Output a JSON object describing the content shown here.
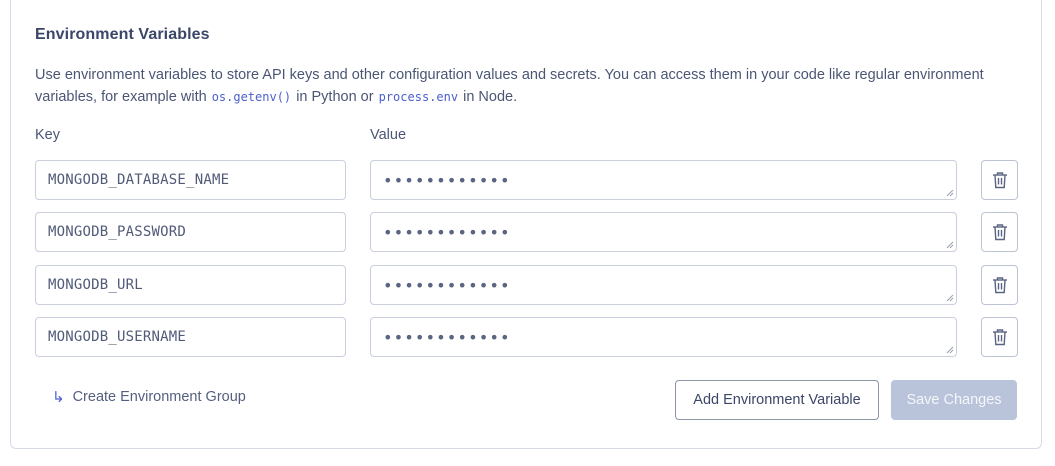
{
  "section": {
    "title": "Environment Variables",
    "description": {
      "part1": "Use environment variables to store API keys and other configuration values and secrets. You can access them in your code like regular environment variables, for example with ",
      "code1": "os.getenv()",
      "part2": " in Python or ",
      "code2": "process.env",
      "part3": " in Node."
    }
  },
  "columns": {
    "key": "Key",
    "value": "Value"
  },
  "variables": [
    {
      "key": "MONGODB_DATABASE_NAME",
      "value": "••••••••••••"
    },
    {
      "key": "MONGODB_PASSWORD",
      "value": "••••••••••••"
    },
    {
      "key": "MONGODB_URL",
      "value": "••••••••••••"
    },
    {
      "key": "MONGODB_USERNAME",
      "value": "••••••••••••"
    }
  ],
  "actions": {
    "create_group": "Create Environment Group",
    "add_variable": "Add Environment Variable",
    "save": "Save Changes"
  },
  "icons": {
    "delete": "trash-icon",
    "group": "return-arrow-icon"
  },
  "colors": {
    "accent": "#4a5fd0",
    "save_disabled_bg": "#b9c4da",
    "border": "#c9cfdd"
  }
}
